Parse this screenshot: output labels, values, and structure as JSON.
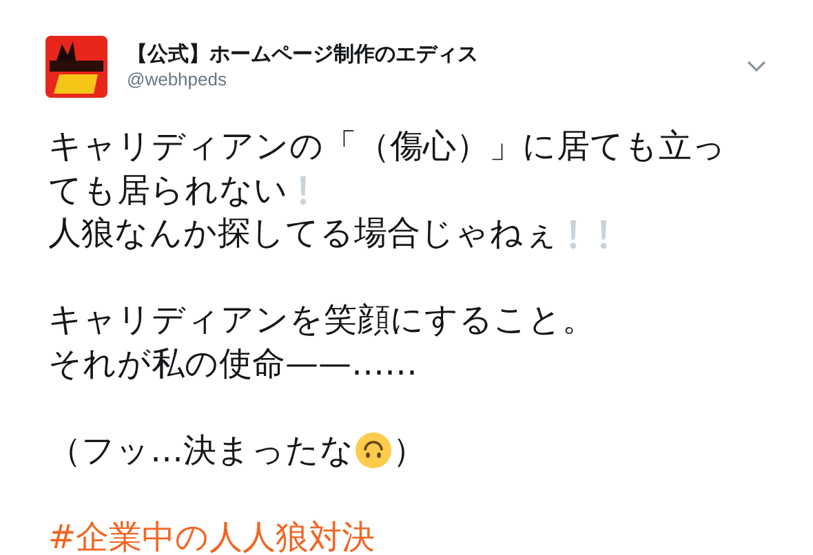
{
  "author": {
    "name": "【公式】ホームページ制作のエディス",
    "handle": "@webhpeds"
  },
  "paragraphs": [
    [
      [
        {
          "kind": "text",
          "text": "キャリディアンの「（傷心）」に居ても立っ"
        }
      ],
      [
        {
          "kind": "text",
          "text": "ても居られない"
        },
        {
          "kind": "mark"
        }
      ],
      [
        {
          "kind": "text",
          "text": "人狼なんか探してる場合じゃねぇ"
        },
        {
          "kind": "mark"
        },
        {
          "kind": "mark"
        }
      ]
    ],
    [
      [
        {
          "kind": "text",
          "text": "キャリディアンを笑顔にすること。"
        }
      ],
      [
        {
          "kind": "text",
          "text": "それが私の使命——……"
        }
      ]
    ],
    [
      [
        {
          "kind": "text",
          "text": "（フッ…決まったな"
        },
        {
          "kind": "face"
        },
        {
          "kind": "text",
          "text": "）"
        }
      ]
    ],
    [
      [
        {
          "kind": "hashtag",
          "text": "#企業中の人人狼対決"
        }
      ]
    ]
  ]
}
